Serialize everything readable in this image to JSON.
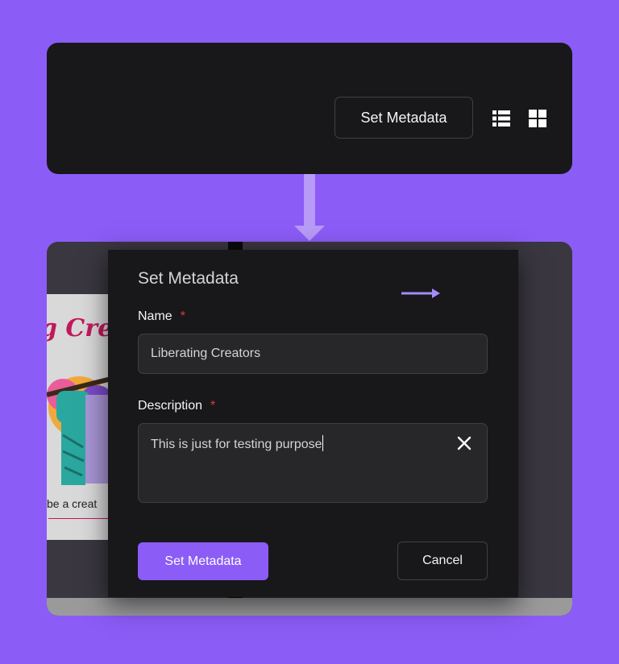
{
  "toolbar": {
    "set_metadata_label": "Set Metadata",
    "icons": [
      "list-view-icon",
      "grid-view-icon"
    ]
  },
  "thumbnail": {
    "title": "g Creat",
    "caption": "be a creat"
  },
  "modal": {
    "title": "Set Metadata",
    "name_label": "Name",
    "name_required": "*",
    "name_value": "Liberating Creators",
    "description_label": "Description",
    "description_required": "*",
    "description_value": "This is just for testing purpose",
    "submit_label": "Set Metadata",
    "cancel_label": "Cancel"
  },
  "colors": {
    "background": "#8b5cf6",
    "panel": "#18181b",
    "accent": "#8b5cf6",
    "required": "#e53935"
  }
}
